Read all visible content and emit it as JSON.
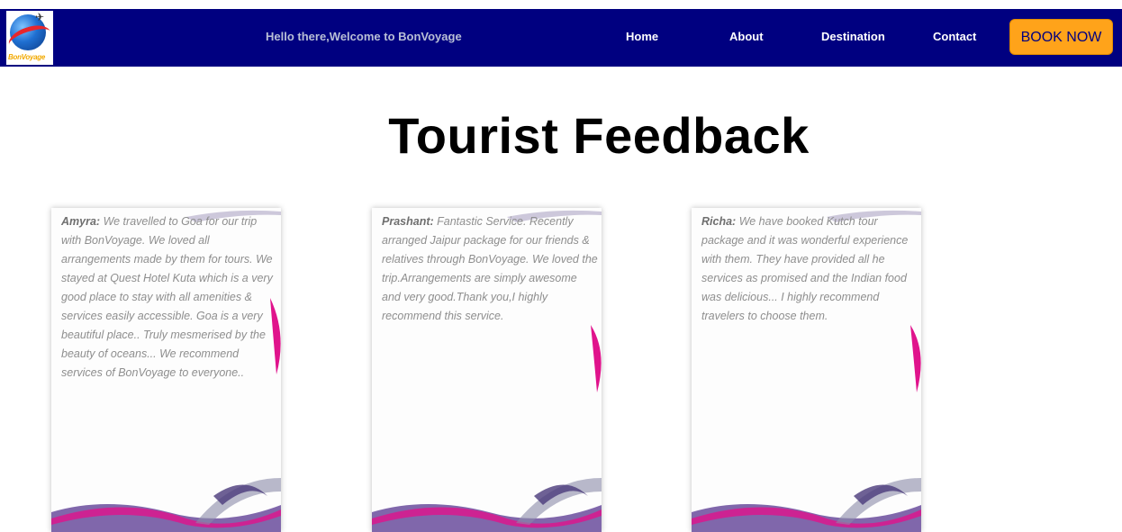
{
  "navbar": {
    "logo_text": "BonVoyage",
    "welcome": "Hello there,Welcome to BonVoyage",
    "links": [
      "Home",
      "About",
      "Destination",
      "Contact"
    ],
    "book_button": "BOOK NOW"
  },
  "main": {
    "title": "Tourist Feedback",
    "feedback": [
      {
        "name": "Amyra:",
        "text": "We travelled to Goa for our trip with BonVoyage. We loved all arrangements made by them for tours. We stayed at Quest Hotel Kuta which is a very good place to stay with all amenities & services easily accessible. Goa is a very beautiful place.. Truly mesmerised by the beauty of oceans... We recommend services of BonVoyage to everyone.."
      },
      {
        "name": "Prashant:",
        "text": "Fantastic Service. Recently arranged Jaipur package for our friends & relatives through BonVoyage. We loved the trip.Arrangements are simply awesome and very good.Thank you,I highly recommend this service."
      },
      {
        "name": "Richa:",
        "text": "We have booked Kutch tour package and it was wonderful experience with them. They have provided all he services as promised and the Indian food was delicious... I highly recommend travelers to choose them."
      }
    ]
  },
  "colors": {
    "navbar_bg": "#000080",
    "book_button_bg": "#ffa31a",
    "accent_magenta": "#e0138c",
    "accent_purple": "#6a4c9c"
  }
}
